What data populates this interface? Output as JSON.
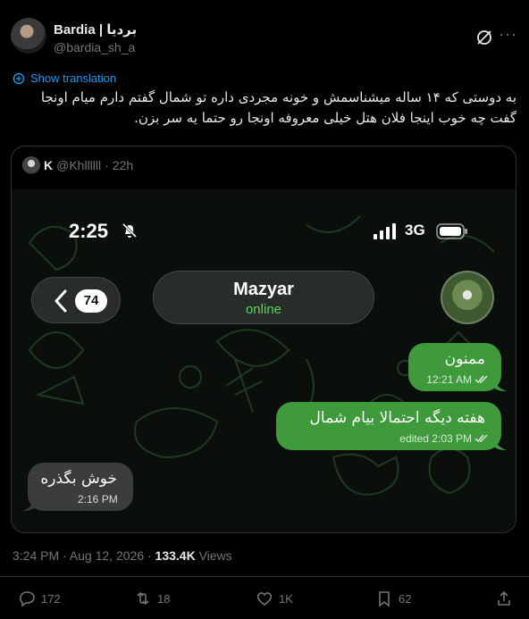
{
  "author": {
    "display_name": "Bardia | بردیا",
    "handle": "@bardia_sh_a"
  },
  "translate_label": "Show translation",
  "tweet_text": "به دوستی که ۱۴ ساله میشناسمش و خونه مجردی داره تو شمال گفتم دارم میام اونجا گفت چه خوب اینجا فلان هتل خیلی معروفه اونجا رو حتما یه سر بزن.",
  "quoted": {
    "author_name": "K",
    "author_handle": "@Khllllll",
    "time": "22h",
    "screenshot": {
      "status_time": "2:25",
      "network": "3G",
      "unread_count": "74",
      "contact_name": "Mazyar",
      "contact_status": "online",
      "messages": [
        {
          "direction": "out",
          "text": "ممنون",
          "meta": "12:21 AM"
        },
        {
          "direction": "out",
          "text": "هفته دیگه احتمالا بیام شمال",
          "meta": "edited 2:03 PM"
        },
        {
          "direction": "in",
          "text": "خوش بگذره",
          "meta": "2:16 PM"
        }
      ]
    }
  },
  "timestamp": {
    "time": "3:24 PM · Aug 12, 2026 · ",
    "views_count": "133.4K",
    "views_label": " Views"
  },
  "actions": {
    "replies": "172",
    "reposts": "18",
    "likes": "1K",
    "bookmarks": "62"
  },
  "colors": {
    "link_blue": "#1d9bf0",
    "outgoing_bubble": "#3f9a3c",
    "incoming_bubble": "#3a3d3b",
    "online_green": "#5bd45b"
  },
  "icons": [
    "grok-icon",
    "more-icon",
    "translate-icon",
    "bell-off-icon",
    "signal-icon",
    "battery-icon",
    "chevron-left-icon",
    "double-check-icon",
    "reply-icon",
    "repost-icon",
    "like-icon",
    "bookmark-icon",
    "share-icon"
  ]
}
